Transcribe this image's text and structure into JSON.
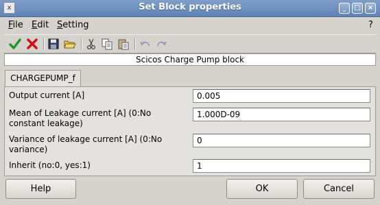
{
  "window": {
    "title": "Set Block properties",
    "icon_text": "x",
    "minimize_glyph": "_",
    "maximize_glyph": "□",
    "close_glyph": "×"
  },
  "menu": {
    "file": "File",
    "edit": "Edit",
    "setting": "Setting",
    "help": "?"
  },
  "toolbar": {
    "icons": [
      "ok-check-icon",
      "cancel-x-icon",
      "save-icon",
      "open-folder-icon",
      "cut-icon",
      "copy-icon",
      "paste-icon",
      "undo-icon",
      "redo-icon"
    ]
  },
  "header": {
    "text": "Scicos Charge Pump block"
  },
  "tab": {
    "label": "CHARGEPUMP_f"
  },
  "fields": [
    {
      "label_line1": "Output current [A]",
      "label_line2": "",
      "value": "0.005"
    },
    {
      "label_line1": "Mean of Leakage current [A] (0:No",
      "label_line2": "constant leakage)",
      "value": "1.000D-09"
    },
    {
      "label_line1": "Variance of leakage current [A] (0:No",
      "label_line2": "variance)",
      "value": "0"
    },
    {
      "label_line1": "Inherit (no:0, yes:1)",
      "label_line2": "",
      "value": "1"
    }
  ],
  "buttons": {
    "help": "Help",
    "ok": "OK",
    "cancel": "Cancel"
  },
  "colors": {
    "titlebar": "#6f90bf",
    "check_green": "#1e9a1e",
    "x_red": "#d01010"
  }
}
